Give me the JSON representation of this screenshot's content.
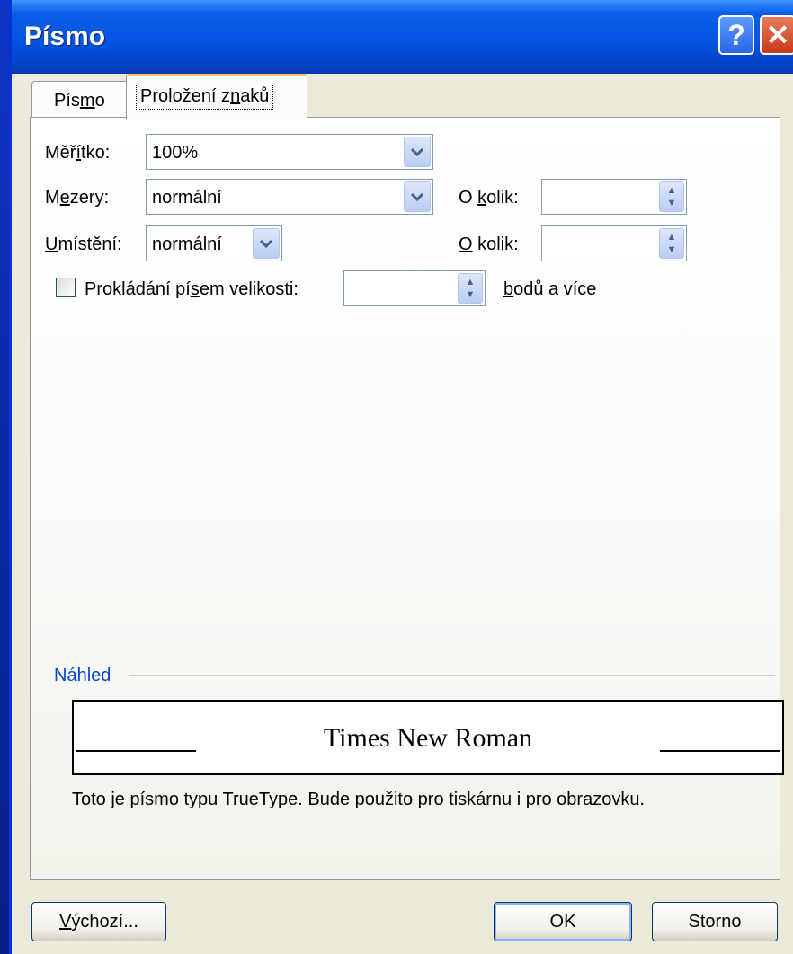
{
  "window": {
    "title": "Písmo",
    "help_label": "?",
    "close_label": "✕"
  },
  "tabs": [
    {
      "label_html": "Pís<u>m</u>o"
    },
    {
      "label_html": "Proložení z<u>n</u>aků"
    }
  ],
  "fields": {
    "meritko": {
      "label_html": "Měř<u>í</u>tko:",
      "value": "100%"
    },
    "mezery": {
      "label_html": "M<u>e</u>zery:",
      "value": "normální",
      "okolik_label_html": "O <u>k</u>olik:",
      "okolik_value": ""
    },
    "umisteni": {
      "label_html": "<u>U</u>místění:",
      "value": "normální",
      "okolik_label_html": "<u>O</u> kolik:",
      "okolik_value": ""
    },
    "prokladani": {
      "label_html": "Prokládání pí<u>s</u>em velikosti:",
      "value": "",
      "suffix_html": "<u>b</u>odů a více",
      "checked": false
    }
  },
  "preview": {
    "label": "Náhled",
    "sample_text": "Times New Roman",
    "info": "Toto je písmo typu TrueType. Bude použito pro tiskárnu i pro obrazovku."
  },
  "buttons": {
    "default_html": "<u>V</u>ýchozí...",
    "ok": "OK",
    "cancel": "Storno"
  },
  "icons": {
    "dropdown": "chevron-down-icon",
    "spin": "spin-arrows-icon",
    "checkbox": "checkbox-icon"
  },
  "colors": {
    "titlebar": "#0554e3",
    "accent_link": "#0046d5",
    "tab_highlight": "#ffc83c",
    "close": "#c8391a"
  }
}
